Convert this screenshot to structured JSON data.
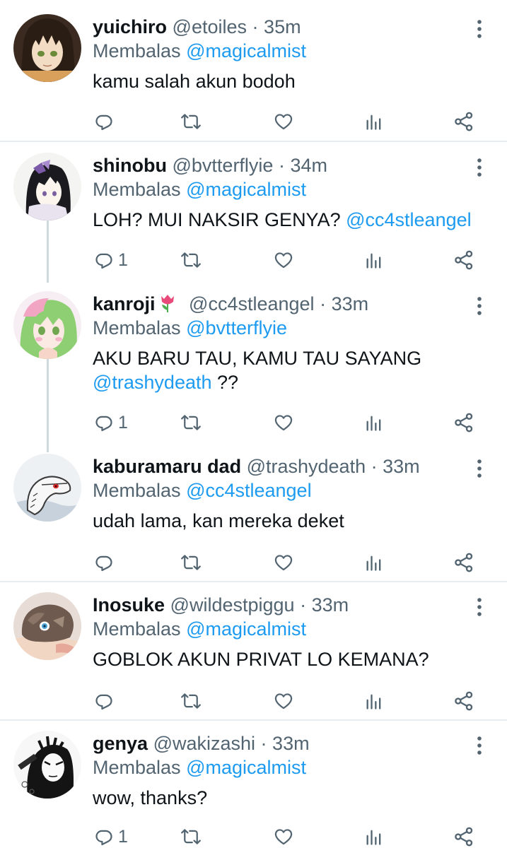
{
  "replying_prefix": "Membalas",
  "colors": {
    "link": "#1d9bf0",
    "secondary": "#536471",
    "divider": "#e6ecf0"
  },
  "icons": {
    "reply": "reply-icon",
    "retweet": "retweet-icon",
    "like": "heart-icon",
    "views": "views-icon",
    "share": "share-icon",
    "more": "more-options-icon"
  },
  "tweets": [
    {
      "name": "yuichiro",
      "handle": "@etoiles",
      "separator": "·",
      "time": "35m",
      "reply_to": "@magicalmist",
      "text": "kamu salah akun bodoh",
      "reply_count": ""
    },
    {
      "name": "shinobu",
      "handle": "@bvtterflyie",
      "separator": "·",
      "time": "34m",
      "reply_to": "@magicalmist",
      "text": "LOH? MUI NAKSIR GENYA?",
      "text_mention": "@cc4stleangel",
      "reply_count": "1"
    },
    {
      "name": "kanroji",
      "handle": "@cc4stleangel",
      "separator": "·",
      "time": "33m",
      "reply_to": "@bvtterflyie",
      "text": "AKU BARU TAU, KAMU TAU SAYANG",
      "text_mention": "@trashydeath",
      "text_after": "??",
      "reply_count": "1"
    },
    {
      "name": "kaburamaru dad",
      "handle": "@trashydeath",
      "separator": "·",
      "time": "33m",
      "reply_to": "@cc4stleangel",
      "text": "udah lama, kan mereka deket",
      "reply_count": ""
    },
    {
      "name": "Inosuke",
      "handle": "@wildestpiggu",
      "separator": "·",
      "time": "33m",
      "reply_to": "@magicalmist",
      "text": "GOBLOK AKUN PRIVAT LO KEMANA?",
      "reply_count": ""
    },
    {
      "name": "genya",
      "handle": "@wakizashi",
      "separator": "·",
      "time": "33m",
      "reply_to": "@magicalmist",
      "text": "wow, thanks?",
      "reply_count": "1"
    }
  ]
}
